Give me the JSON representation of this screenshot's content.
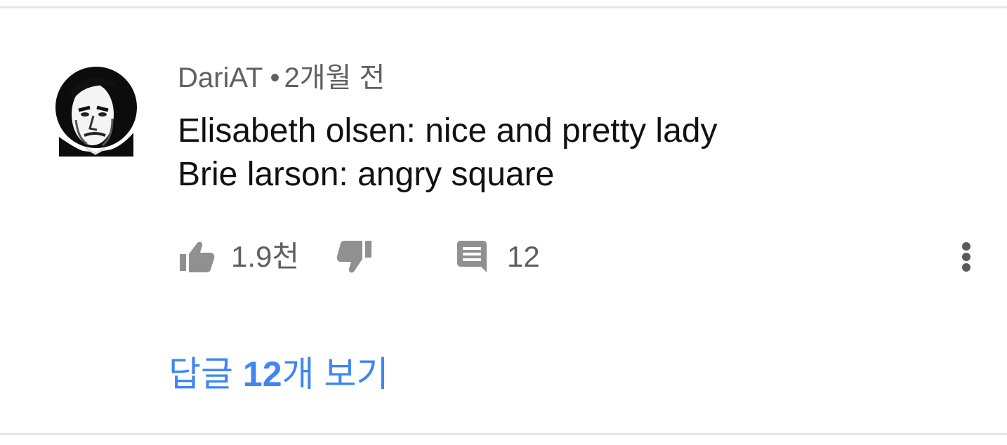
{
  "comment": {
    "author": "DariAT",
    "separator": "•",
    "time_ago": "2개월 전",
    "lines": [
      "Elisabeth olsen: nice and pretty lady",
      "Brie larson: angry square"
    ],
    "avatar_icon": "user-avatar-icon"
  },
  "actions": {
    "like_icon": "thumbs-up-icon",
    "like_count": "1.9천",
    "dislike_icon": "thumbs-down-icon",
    "reply_icon": "comment-icon",
    "reply_count": "12",
    "more_icon": "more-vert-icon"
  },
  "replies": {
    "prefix": "답글 ",
    "count": "12",
    "suffix": "개 보기",
    "color": "#3f86f0"
  },
  "colors": {
    "meta_text": "#606060",
    "body_text": "#111111",
    "icon": "#909090",
    "divider": "#e6e6e6"
  }
}
